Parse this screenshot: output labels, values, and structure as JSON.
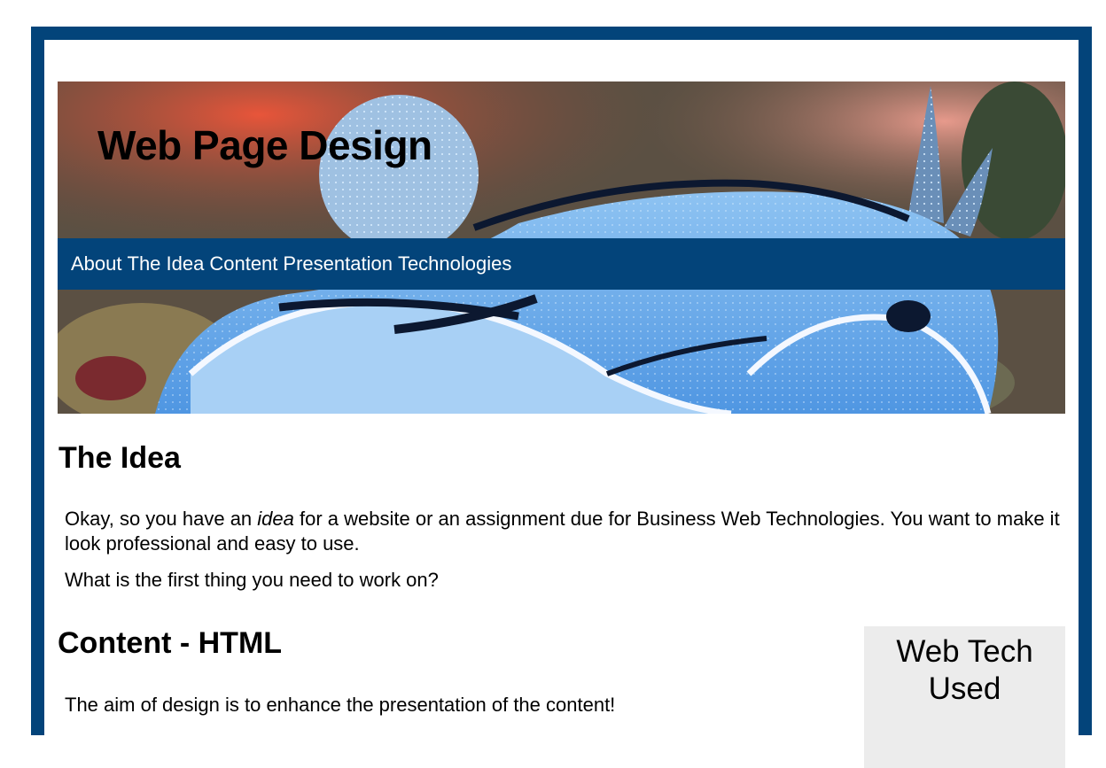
{
  "header": {
    "site_title": "Web Page Design"
  },
  "nav": {
    "items": [
      {
        "label": "About"
      },
      {
        "label": "The Idea"
      },
      {
        "label": "Content"
      },
      {
        "label": "Presentation"
      },
      {
        "label": "Technologies"
      }
    ]
  },
  "sections": {
    "idea": {
      "heading": "The Idea",
      "p1_before": "Okay, so you have an ",
      "p1_em": "idea",
      "p1_after": " for a website or an assignment due for Business Web Technologies. You want to make it look professional and easy to use.",
      "p2": "What is the first thing you need to work on?"
    },
    "content": {
      "heading": "Content - HTML",
      "p1": "The aim of design is to enhance the presentation of the content!"
    }
  },
  "sidebar": {
    "title": "Web Tech Used"
  },
  "colors": {
    "brand": "#03447a",
    "sidebar_bg": "#ececec"
  },
  "images": {
    "banner": "sea-slug-photo"
  }
}
